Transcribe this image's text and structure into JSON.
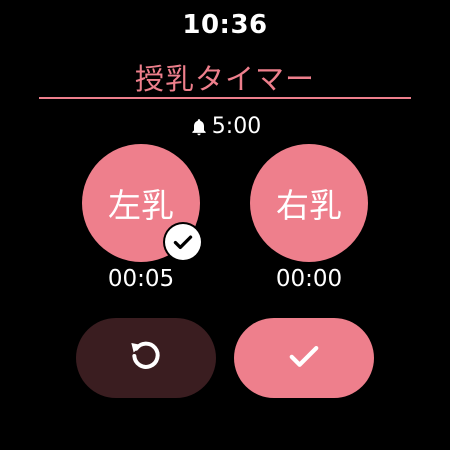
{
  "status_bar": {
    "time": "10:36"
  },
  "header": {
    "title": "授乳タイマー"
  },
  "alarm": {
    "icon": "bell-icon",
    "value": "5:00"
  },
  "sides": [
    {
      "label": "左乳",
      "elapsed": "00:05",
      "selected": true
    },
    {
      "label": "右乳",
      "elapsed": "00:00",
      "selected": false
    }
  ],
  "actions": {
    "reset_icon": "reset-icon",
    "confirm_icon": "check-icon"
  },
  "colors": {
    "accent": "#ee7f8c",
    "reset_bg": "#3a1d20",
    "background": "#000000"
  }
}
